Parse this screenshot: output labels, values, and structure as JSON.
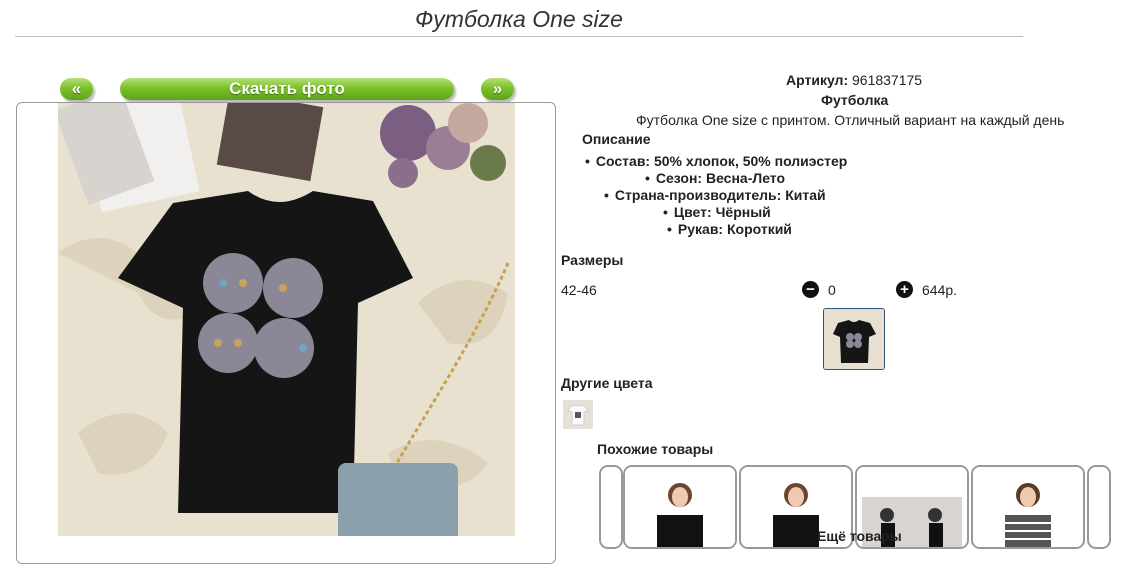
{
  "product": {
    "title": "Футболка One size",
    "article_label": "Артикул:",
    "article_value": "961837175",
    "name": "Футболка",
    "short_description": "Футболка One size с принтом. Отличный вариант на каждый день",
    "description_heading": "Описание",
    "specs": [
      "Состав: 50% хлопок, 50% полиэстер",
      "Сезон: Весна-Лето",
      "Страна-производитель: Китай",
      "Цвет: Чёрный",
      "Рукав: Короткий"
    ]
  },
  "gallery": {
    "prev_label": "«",
    "download_label": "Скачать фото",
    "next_label": "»"
  },
  "sizes": {
    "heading": "Размеры",
    "rows": [
      {
        "size": "42-46",
        "quantity": "0",
        "price": "644р."
      }
    ]
  },
  "other_colors": {
    "heading": "Другие цвета"
  },
  "similar": {
    "heading": "Похожие товары",
    "more_label": "Ещё товары"
  },
  "icons": {
    "minus": "minus-circle-icon",
    "plus": "plus-circle-icon"
  },
  "colors": {
    "accent_green": "#7cc12a",
    "thumb_border": "#33517a"
  }
}
